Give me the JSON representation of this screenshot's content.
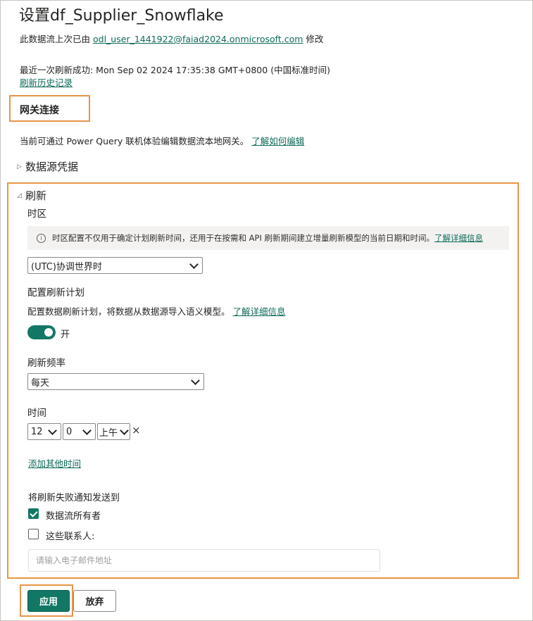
{
  "header": {
    "title": "设置df_Supplier_Snowflake",
    "modified_prefix": "此数据流上次已由",
    "modified_user": "odl_user_1441922@faiad2024.onmicrosoft.com",
    "modified_suffix": "修改",
    "last_refresh": "最近一次刷新成功: Mon Sep 02 2024 17:35:38 GMT+0800 (中国标准时间)",
    "refresh_history_link": "刷新历史记录"
  },
  "gateway": {
    "title": "网关连接",
    "description": "当前可通过 Power Query 联机体验编辑数据流本地网关。",
    "learn_link": "了解如何编辑"
  },
  "data_source": {
    "label": "数据源凭据"
  },
  "refresh": {
    "label": "刷新",
    "timezone_label": "时区",
    "timezone_info": "时区配置不仅用于确定计划刷新时间，还用于在按需和 API 刷新期间建立增量刷新模型的当前日期和时间。",
    "timezone_info_link": "了解详细信息",
    "timezone_value": "(UTC)协调世界时",
    "schedule_label": "配置刷新计划",
    "schedule_description": "配置数据刷新计划，将数据从数据源导入语义模型。",
    "schedule_link": "了解详细信息",
    "toggle_state": "开",
    "frequency_label": "刷新频率",
    "frequency_value": "每天",
    "time_label": "时间",
    "time_hour": "12",
    "time_minute": "0",
    "time_ampm": "上午",
    "remove_time_glyph": "×",
    "add_time_link": "添加其他时间",
    "notify_label": "将刷新失败通知发送到",
    "notify_owner": "数据流所有者",
    "notify_owner_checked": true,
    "notify_contacts": "这些联系人:",
    "notify_contacts_checked": false,
    "email_placeholder": "请输入电子邮件地址"
  },
  "actions": {
    "apply": "应用",
    "discard": "放弃"
  },
  "colors": {
    "accent": "#117865",
    "highlight": "#e8954a",
    "link": "#0f6a5a"
  }
}
